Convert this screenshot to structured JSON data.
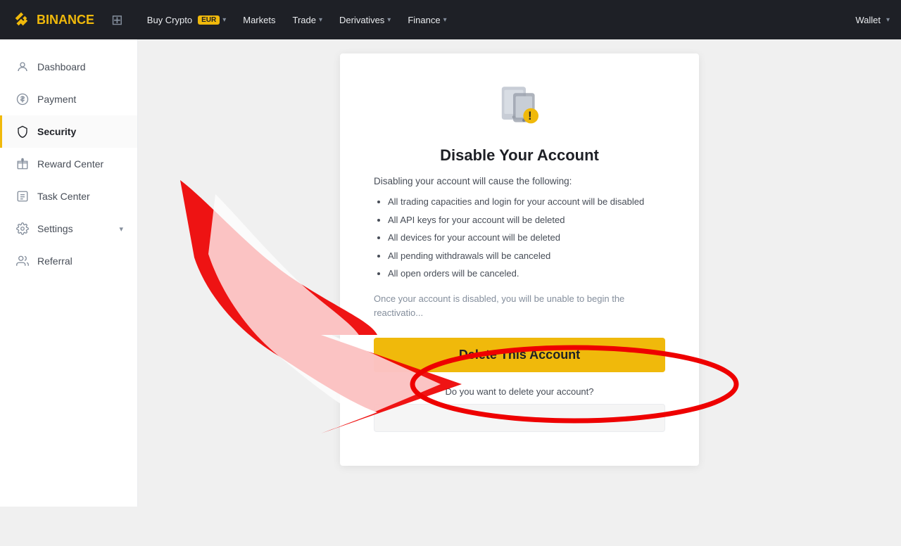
{
  "topnav": {
    "logo_text": "BINANCE",
    "buy_crypto_label": "Buy Crypto",
    "buy_crypto_badge": "EUR",
    "markets_label": "Markets",
    "trade_label": "Trade",
    "derivatives_label": "Derivatives",
    "finance_label": "Finance",
    "wallet_label": "Wallet"
  },
  "sidebar": {
    "items": [
      {
        "label": "Dashboard",
        "icon": "person"
      },
      {
        "label": "Payment",
        "icon": "dollar"
      },
      {
        "label": "Security",
        "icon": "shield",
        "active": true
      },
      {
        "label": "Reward Center",
        "icon": "gift"
      },
      {
        "label": "Task Center",
        "icon": "list"
      },
      {
        "label": "Settings",
        "icon": "settings",
        "has_arrow": true
      },
      {
        "label": "Referral",
        "icon": "users"
      }
    ]
  },
  "modal": {
    "title": "Disable Your Account",
    "subtitle": "Disabling your account will cause the following:",
    "list_items": [
      "All trading capacities and login for your account will be disabled",
      "All API keys for your account will be deleted",
      "All devices for your account will be deleted",
      "All pending withdrawals will be canceled",
      "All open orders will be canceled."
    ],
    "note": "Once your account is disabled, you will be unable to begin the reactivatio...",
    "delete_button_label": "Delete This Account",
    "question": "Do you want to delete your account?",
    "input_placeholder": ""
  }
}
